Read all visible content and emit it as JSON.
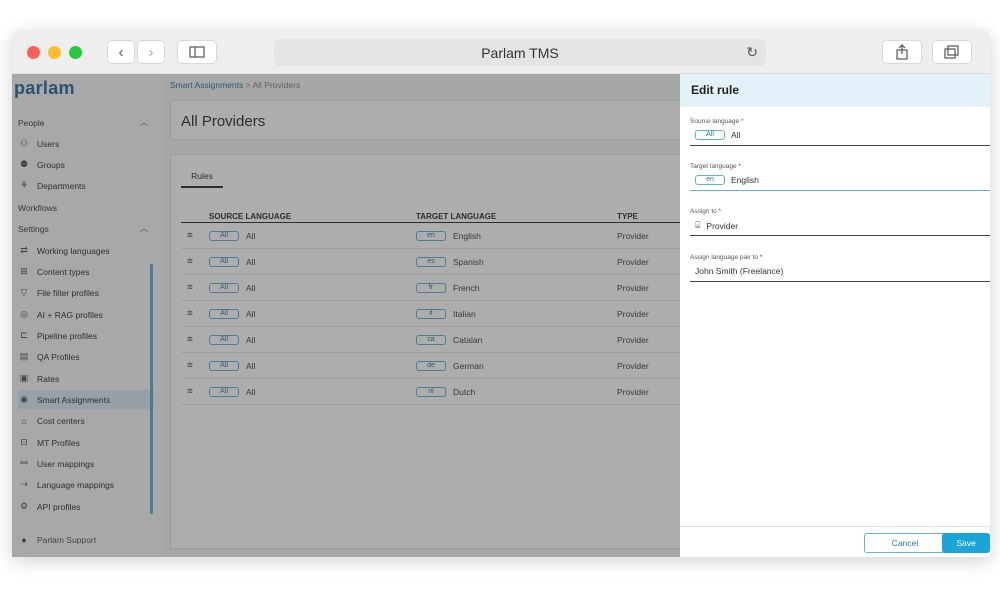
{
  "browser": {
    "url_title": "Parlam TMS",
    "traffic_colors": {
      "close": "#fe5f57",
      "minimize": "#febc2e",
      "maximize": "#28c840"
    }
  },
  "sidebar": {
    "logo": "parlam",
    "items": [
      {
        "label": "People",
        "icon": "",
        "section": true
      },
      {
        "label": "Users",
        "icon": "user-icon"
      },
      {
        "label": "Groups",
        "icon": "groups-icon"
      },
      {
        "label": "Departments",
        "icon": "departments-icon"
      },
      {
        "label": "Workflows",
        "icon": "",
        "section": true
      },
      {
        "label": "Settings",
        "icon": "",
        "section": true
      },
      {
        "label": "Working languages",
        "icon": "arrows-icon"
      },
      {
        "label": "Content types",
        "icon": "content-types-icon"
      },
      {
        "label": "File filter profiles",
        "icon": "filter-icon"
      },
      {
        "label": "AI + RAG profiles",
        "icon": "ai-icon"
      },
      {
        "label": "Pipeline profiles",
        "icon": "pipeline-icon"
      },
      {
        "label": "QA Profiles",
        "icon": "qa-icon"
      },
      {
        "label": "Rates",
        "icon": "rates-icon"
      },
      {
        "label": "Smart Assignments",
        "icon": "smart-assign-icon",
        "active": true
      },
      {
        "label": "Cost centers",
        "icon": "cost-icon"
      },
      {
        "label": "MT Profiles",
        "icon": "mt-icon"
      },
      {
        "label": "User mappings",
        "icon": "user-mappings-icon"
      },
      {
        "label": "Language mappings",
        "icon": "language-mappings-icon"
      },
      {
        "label": "API profiles",
        "icon": "api-icon"
      }
    ],
    "support": "Parlam Support"
  },
  "main": {
    "breadcrumb": {
      "parent": "Smart Assignments",
      "separator": ">",
      "current": "All Providers"
    },
    "title": "All Providers",
    "tab": "Rules",
    "columns": [
      "SOURCE LANGUAGE",
      "TARGET LANGUAGE",
      "TYPE"
    ],
    "rows": [
      {
        "src_code": "All",
        "src": "All",
        "tgt_code": "en",
        "tgt": "English",
        "type": "Provider"
      },
      {
        "src_code": "All",
        "src": "All",
        "tgt_code": "es",
        "tgt": "Spanish",
        "type": "Provider"
      },
      {
        "src_code": "All",
        "src": "All",
        "tgt_code": "fr",
        "tgt": "French",
        "type": "Provider"
      },
      {
        "src_code": "All",
        "src": "All",
        "tgt_code": "it",
        "tgt": "Italian",
        "type": "Provider"
      },
      {
        "src_code": "All",
        "src": "All",
        "tgt_code": "ca",
        "tgt": "Catalan",
        "type": "Provider"
      },
      {
        "src_code": "All",
        "src": "All",
        "tgt_code": "de",
        "tgt": "German",
        "type": "Provider"
      },
      {
        "src_code": "All",
        "src": "All",
        "tgt_code": "nl",
        "tgt": "Dutch",
        "type": "Provider"
      }
    ]
  },
  "panel": {
    "title": "Edit rule",
    "source_label": "Source language *",
    "source_code": "All",
    "source_value": "All",
    "target_label": "Target language *",
    "target_code": "en",
    "target_value": "English",
    "assign_label": "Assign to *",
    "assign_value": "Provider",
    "pair_label": "Assign language pair to *",
    "pair_value": "John Smith (Freelance)",
    "cancel": "Cancel",
    "save": "Save"
  }
}
